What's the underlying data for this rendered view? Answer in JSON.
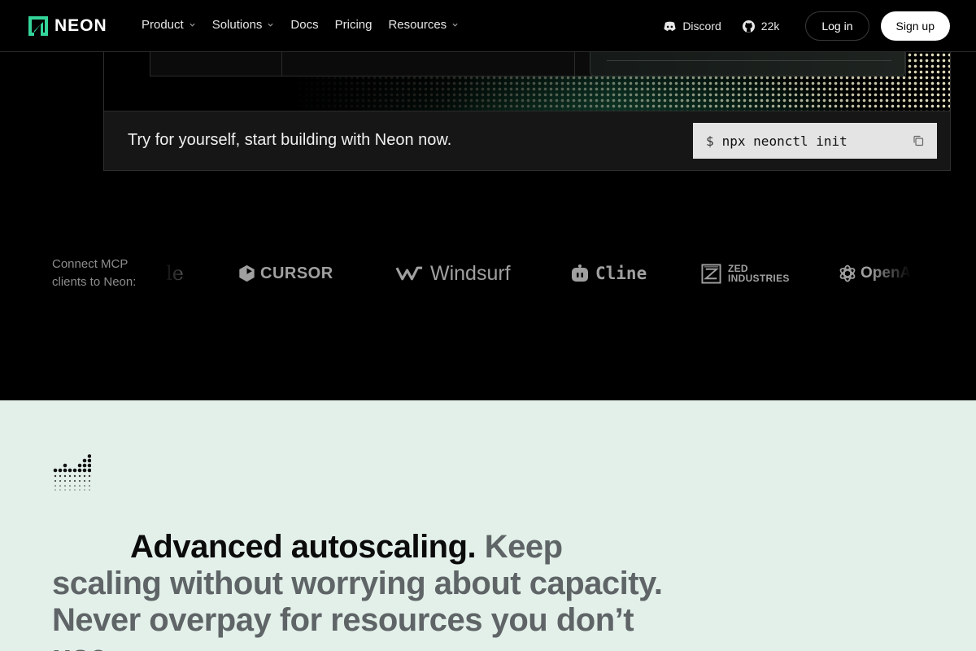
{
  "nav": {
    "logo_text": "NEON",
    "links": [
      {
        "label": "Product",
        "dropdown": true
      },
      {
        "label": "Solutions",
        "dropdown": true
      },
      {
        "label": "Docs",
        "dropdown": false
      },
      {
        "label": "Pricing",
        "dropdown": false
      },
      {
        "label": "Resources",
        "dropdown": true
      }
    ],
    "discord_label": "Discord",
    "github_count": "22k",
    "login_label": "Log in",
    "signup_label": "Sign up"
  },
  "cta": {
    "text": "Try for yourself, start building with Neon now.",
    "prompt": "$",
    "command": "npx neonctl init"
  },
  "mcp": {
    "label": "Connect MCP clients to Neon:",
    "clients": [
      {
        "name": "Claude",
        "visible_text": "le",
        "icon": "claude-logo"
      },
      {
        "name": "Cursor",
        "visible_text": "CURSOR",
        "icon": "cursor-logo"
      },
      {
        "name": "Windsurf",
        "visible_text": "Windsurf",
        "icon": "windsurf-logo"
      },
      {
        "name": "Cline",
        "visible_text": "Cline",
        "icon": "cline-logo"
      },
      {
        "name": "Zed Industries",
        "visible_text": "ZED INDUSTRIES",
        "line1": "ZED",
        "line2": "INDUSTRIES",
        "icon": "zed-logo"
      },
      {
        "name": "OpenAI",
        "visible_text": "OpenAI",
        "icon": "openai-logo"
      }
    ]
  },
  "feature": {
    "headline_strong": "Advanced autoscaling.",
    "headline_rest": "Keep scaling without worrying about capacity. Never overpay for resources you don’t use."
  },
  "colors": {
    "accent": "#34d59a",
    "page_bg": "#000000",
    "feature_bg": "#e3f0ea"
  }
}
